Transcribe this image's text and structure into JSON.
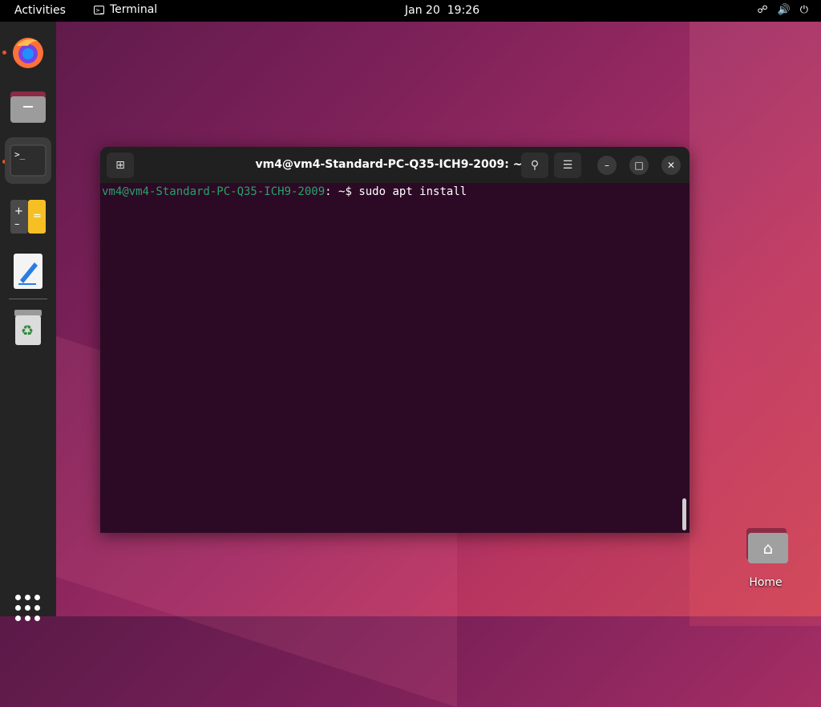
{
  "topbar": {
    "activities": "Activities",
    "app_name": "Terminal",
    "date": "Jan 20",
    "time": "19:26"
  },
  "dock": {
    "apps": [
      "Firefox",
      "Files",
      "Terminal",
      "Calculator",
      "Text Editor",
      "Trash"
    ],
    "show_apps": "Show Applications"
  },
  "terminal": {
    "title": "vm4@vm4-Standard-PC-Q35-ICH9-2009: ~",
    "prompt": "vm4@vm4-Standard-PC-Q35-ICH9-2009",
    "path_sep": ":",
    "path": " ~$ ",
    "command": "sudo apt install"
  },
  "desktop": {
    "home_label": "Home"
  },
  "colors": {
    "accent": "#e95420",
    "prompt": "#26a269",
    "terminal_bg": "#2c0a25"
  }
}
